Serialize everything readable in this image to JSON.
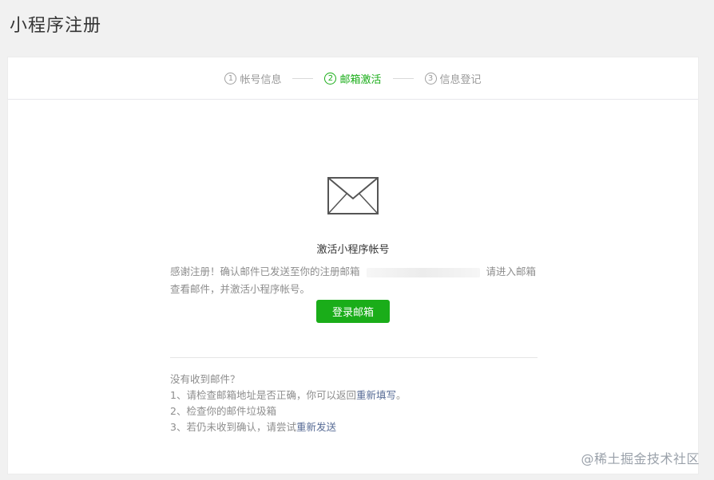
{
  "page": {
    "title": "小程序注册"
  },
  "steps": [
    {
      "num": "1",
      "label": "帐号信息"
    },
    {
      "num": "2",
      "label": "邮箱激活"
    },
    {
      "num": "3",
      "label": "信息登记"
    }
  ],
  "activation": {
    "icon": "envelope-icon",
    "title": "激活小程序帐号",
    "desc_before": "感谢注册！确认邮件已发送至你的注册邮箱",
    "desc_after": "请进入邮箱查看邮件，并激活小程序帐号。",
    "login_button": "登录邮箱"
  },
  "help": {
    "heading": "没有收到邮件？",
    "line1_text": "1、请检查邮箱地址是否正确，你可以返回",
    "line1_link": "重新填写",
    "line1_end": "。",
    "line2_text": "2、检查你的邮件垃圾箱",
    "line3_text": "3、若仍未收到确认，请尝试",
    "line3_link": "重新发送"
  },
  "watermark": "@稀土掘金技术社区",
  "colors": {
    "accent": "#1aad19",
    "link": "#576b95"
  }
}
